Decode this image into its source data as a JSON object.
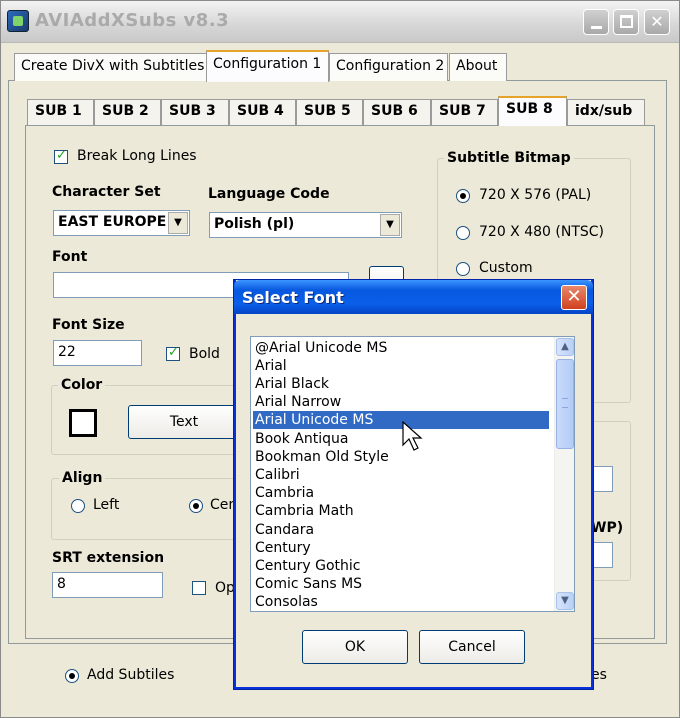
{
  "window": {
    "title": "AVIAddXSubs v8.3",
    "buttons": {
      "minimize": "_",
      "maximize": "□",
      "close": "✕"
    }
  },
  "main_tabs": [
    "Create DivX with Subtitles",
    "Configuration 1",
    "Configuration 2",
    "About"
  ],
  "active_main_tab": "Configuration 1",
  "sub_tabs": [
    "SUB 1",
    "SUB 2",
    "SUB 3",
    "SUB 4",
    "SUB 5",
    "SUB 6",
    "SUB 7",
    "SUB 8",
    "idx/sub"
  ],
  "active_sub_tab": "SUB 8",
  "form": {
    "break_long_lines": {
      "label": "Break Long Lines",
      "checked": true
    },
    "character_set": {
      "label": "Character Set",
      "value": "EAST EUROPE"
    },
    "language_code": {
      "label": "Language Code",
      "value": "Polish (pl)"
    },
    "font": {
      "label": "Font",
      "value": ""
    },
    "font_size": {
      "label": "Font Size",
      "value": "22"
    },
    "bold": {
      "label": "Bold",
      "checked": true
    },
    "color": {
      "label": "Color",
      "text_button": "Text"
    },
    "align": {
      "label": "Align",
      "left": "Left",
      "center_partial": "Cen"
    },
    "srt_extension": {
      "label": "SRT extension",
      "value": "8"
    },
    "op_partial": "Op",
    "subtitle_bitmap": {
      "label": "Subtitle Bitmap",
      "options": [
        "720 X 576 (PAL)",
        "720 X 480 (NTSC)",
        "Custom"
      ],
      "selected": "720 X 576 (PAL)"
    },
    "wp_partial": "WP)",
    "add_subtitles": {
      "label": "Add Subtiles",
      "checked": true
    },
    "es_partial": "es"
  },
  "dialog": {
    "title": "Select Font",
    "fonts": [
      "@Arial Unicode MS",
      "Arial",
      "Arial Black",
      "Arial Narrow",
      "Arial Unicode MS",
      "Book Antiqua",
      "Bookman Old Style",
      "Calibri",
      "Cambria",
      "Cambria Math",
      "Candara",
      "Century",
      "Century Gothic",
      "Comic Sans MS",
      "Consolas"
    ],
    "selected_font": "Arial Unicode MS",
    "ok_label": "OK",
    "cancel_label": "Cancel"
  }
}
